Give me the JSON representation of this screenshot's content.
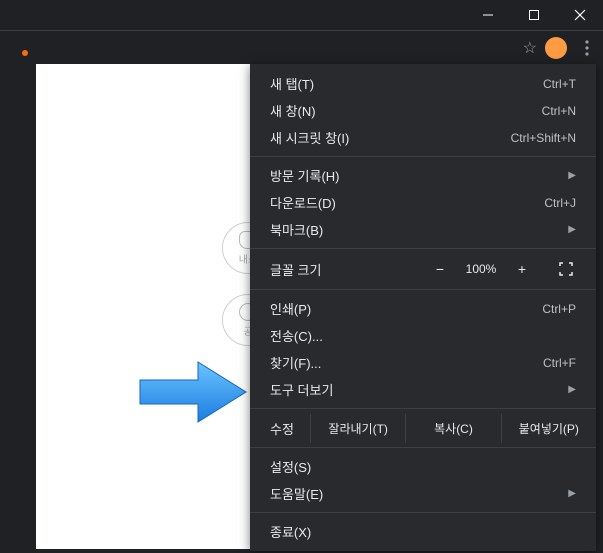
{
  "titlebar": {},
  "toolbar": {},
  "menu": {
    "items": [
      {
        "label": "새 탭(T)",
        "shortcut": "Ctrl+T"
      },
      {
        "label": "새 창(N)",
        "shortcut": "Ctrl+N"
      },
      {
        "label": "새 시크릿 창(I)",
        "shortcut": "Ctrl+Shift+N"
      }
    ],
    "group2": [
      {
        "label": "방문 기록(H)",
        "submenu": true
      },
      {
        "label": "다운로드(D)",
        "shortcut": "Ctrl+J"
      },
      {
        "label": "북마크(B)",
        "submenu": true
      }
    ],
    "zoom": {
      "label": "글꼴 크기",
      "minus": "−",
      "value": "100%",
      "plus": "+"
    },
    "group3": [
      {
        "label": "인쇄(P)",
        "shortcut": "Ctrl+P"
      },
      {
        "label": "전송(C)..."
      },
      {
        "label": "찾기(F)...",
        "shortcut": "Ctrl+F"
      },
      {
        "label": "도구 더보기",
        "submenu": true
      }
    ],
    "edit": {
      "label": "수정",
      "cut": "잘라내기(T)",
      "copy": "복사(C)",
      "paste": "붙여넣기(P)"
    },
    "group4": [
      {
        "label": "설정(S)"
      },
      {
        "label": "도움말(E)",
        "submenu": true
      }
    ],
    "group5": [
      {
        "label": "종료(X)"
      }
    ]
  },
  "page": {
    "round1_label": "내소",
    "round2_label": "공"
  }
}
